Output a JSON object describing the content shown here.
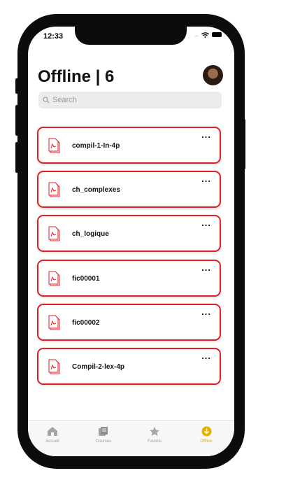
{
  "status_bar": {
    "time": "12:33",
    "signal": "....."
  },
  "header": {
    "title": "Offline | 6"
  },
  "search": {
    "placeholder": "Search"
  },
  "files": [
    {
      "name": "compil-1-In-4p",
      "menu": "..."
    },
    {
      "name": "ch_complexes",
      "menu": "..."
    },
    {
      "name": "ch_logique",
      "menu": "..."
    },
    {
      "name": "fic00001",
      "menu": "..."
    },
    {
      "name": "fic00002",
      "menu": "..."
    },
    {
      "name": "Compil-2-lex-4p",
      "menu": "..."
    }
  ],
  "tabs": [
    {
      "label": "Accueil",
      "icon": "home-icon",
      "active": false
    },
    {
      "label": "Courses",
      "icon": "courses-icon",
      "active": false
    },
    {
      "label": "Favoris",
      "icon": "star-icon",
      "active": false
    },
    {
      "label": "Offline",
      "icon": "download-icon",
      "active": true
    }
  ],
  "colors": {
    "accent": "#e31e24",
    "active_tab": "#e0b100",
    "inactive_tab": "#9c9c9c"
  }
}
